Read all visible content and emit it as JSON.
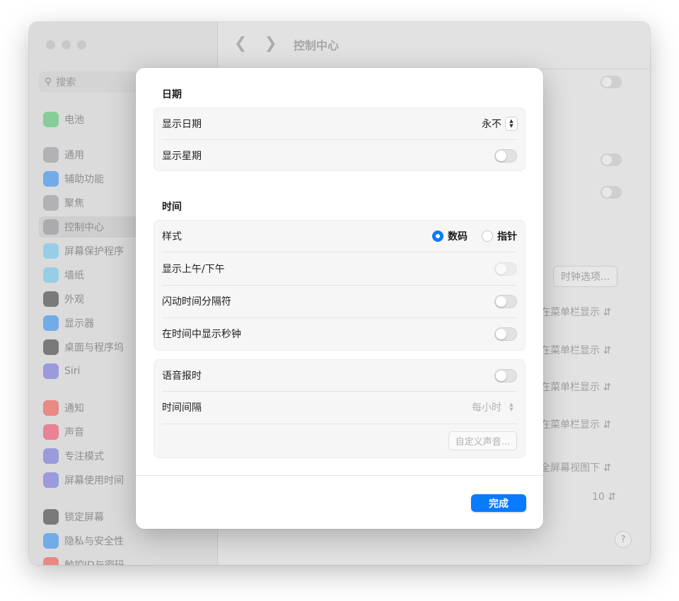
{
  "window": {
    "title": "控制中心",
    "search_placeholder": "搜索"
  },
  "sidebar": {
    "items": [
      {
        "label": "电池",
        "icon": "battery-icon",
        "color": "#34c759"
      },
      {
        "label": "通用",
        "icon": "gear-icon",
        "color": "#8e8e93"
      },
      {
        "label": "辅助功能",
        "icon": "accessibility-icon",
        "color": "#0a84ff"
      },
      {
        "label": "聚焦",
        "icon": "spotlight-icon",
        "color": "#8e8e93"
      },
      {
        "label": "控制中心",
        "icon": "control-center-icon",
        "color": "#8e8e93"
      },
      {
        "label": "屏幕保护程序",
        "icon": "screensaver-icon",
        "color": "#5ac8fa"
      },
      {
        "label": "墙纸",
        "icon": "wallpaper-icon",
        "color": "#5ac8fa"
      },
      {
        "label": "外观",
        "icon": "appearance-icon",
        "color": "#1c1c1e"
      },
      {
        "label": "显示器",
        "icon": "display-icon",
        "color": "#0a84ff"
      },
      {
        "label": "桌面与程序坞",
        "icon": "dock-icon",
        "color": "#1c1c1e"
      },
      {
        "label": "Siri",
        "icon": "siri-icon",
        "color": "#5e5ce6"
      },
      {
        "label": "通知",
        "icon": "notifications-icon",
        "color": "#ff3b30"
      },
      {
        "label": "声音",
        "icon": "sound-icon",
        "color": "#ff2d55"
      },
      {
        "label": "专注模式",
        "icon": "focus-icon",
        "color": "#5e5ce6"
      },
      {
        "label": "屏幕使用时间",
        "icon": "screen-time-icon",
        "color": "#5e5ce6"
      },
      {
        "label": "锁定屏幕",
        "icon": "lock-icon",
        "color": "#1c1c1e"
      },
      {
        "label": "隐私与安全性",
        "icon": "privacy-icon",
        "color": "#0a84ff"
      },
      {
        "label": "触控ID与密码",
        "icon": "touch-id-icon",
        "color": "#ff3b30"
      }
    ]
  },
  "background": {
    "clock_options_button": "时钟选项...",
    "menu_bar_popups": [
      "在菜单栏显示",
      "在菜单栏显示",
      "在菜单栏显示",
      "在菜单栏显示"
    ],
    "fullscreen_popup": "全屏幕视图下",
    "count_value": "10",
    "help_label": "?"
  },
  "sheet": {
    "date_section_title": "日期",
    "show_date_label": "显示日期",
    "show_date_value": "永不",
    "show_weekday_label": "显示星期",
    "time_section_title": "时间",
    "style_label": "样式",
    "style_options": {
      "digital": "数码",
      "analog": "指针"
    },
    "ampm_label": "显示上午/下午",
    "flash_separators_label": "闪动时间分隔符",
    "show_seconds_label": "在时间中显示秒钟",
    "announce_label": "语音报时",
    "interval_label": "时间间隔",
    "interval_value": "每小时",
    "customize_voice_button": "自定义声音...",
    "done_button": "完成"
  },
  "colors": {
    "accent": "#0a7aff"
  }
}
